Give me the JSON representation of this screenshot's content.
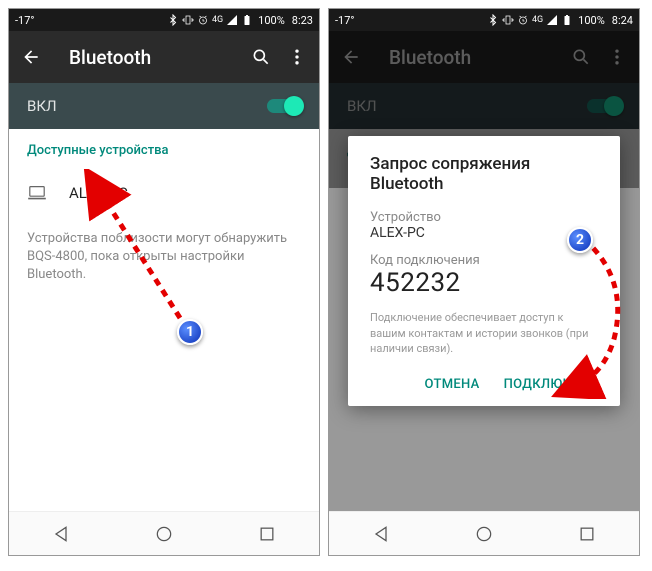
{
  "statusbar": {
    "temp": "-17°",
    "battery": "100%",
    "time_left": "8:23",
    "time_right": "8:24",
    "net": "4G"
  },
  "appbar": {
    "title": "Bluetooth"
  },
  "toggle": {
    "label": "ВКЛ"
  },
  "section": {
    "title": "Доступные устройства"
  },
  "device": {
    "name": "ALEX-PC"
  },
  "info": "Устройства поблизости могут обнаружить BQS-4800, пока открыты настройки Bluetooth.",
  "dialog": {
    "title": "Запрос сопряжения Bluetooth",
    "device_label": "Устройство",
    "device_name": "ALEX-PC",
    "code_label": "Код подключения",
    "code": "452232",
    "info": "Подключение обеспечивает доступ к вашим контактам и истории звонков (при наличии связи).",
    "cancel": "ОТМЕНА",
    "pair": "ПОДКЛЮЧИТЬ"
  },
  "callouts": {
    "one": "1",
    "two": "2"
  }
}
